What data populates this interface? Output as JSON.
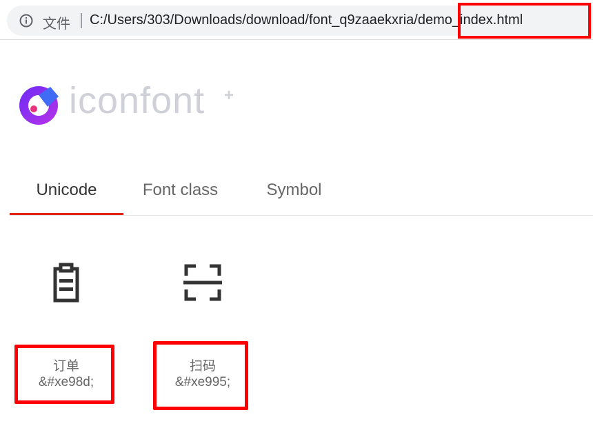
{
  "browser": {
    "file_label": "文件",
    "url_prefix": "C:/Users/303/Downloads/download/font_q9zaaekxria",
    "url_separator": "/",
    "url_last": "demo_index.html"
  },
  "logo": {
    "text": "iconfont",
    "plus": "+"
  },
  "tabs": [
    {
      "label": "Unicode",
      "active": true
    },
    {
      "label": "Font class",
      "active": false
    },
    {
      "label": "Symbol",
      "active": false
    }
  ],
  "icons": [
    {
      "name": "订单",
      "code": "&#xe98d;",
      "icon": "clipboard-icon"
    },
    {
      "name": "扫码",
      "code": "&#xe995;",
      "icon": "scan-icon"
    }
  ],
  "colors": {
    "highlight": "#ff0000",
    "tab_accent": "#e2231a",
    "logo_text": "#cfd0d8"
  }
}
